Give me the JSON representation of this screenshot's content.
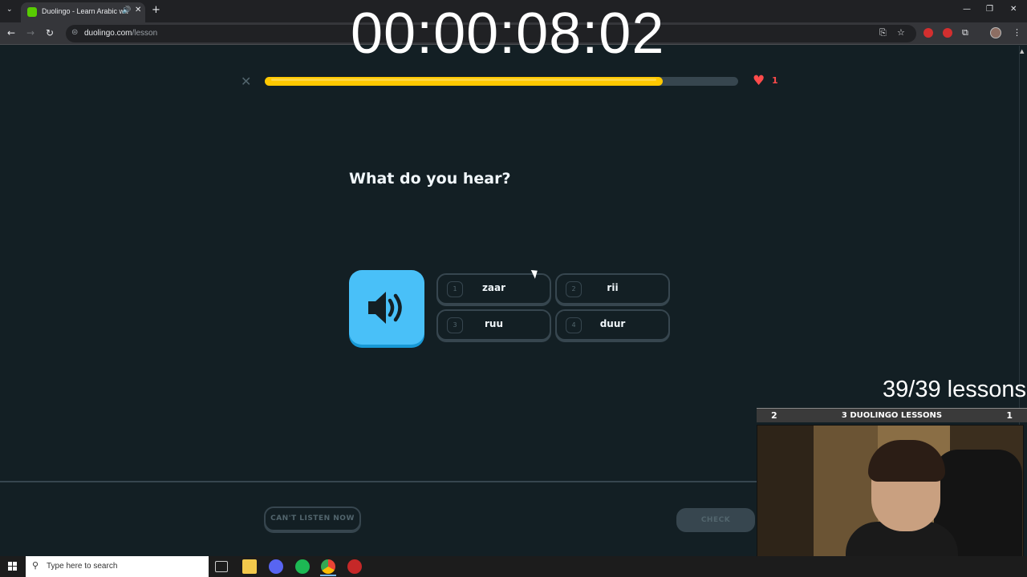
{
  "browser": {
    "tab_title": "Duolingo - Learn Arabic with",
    "url_host": "duolingo.com",
    "url_path": "/lesson"
  },
  "overlay": {
    "timer": "00:00:08:02",
    "lessons_count": "39/39 lessons",
    "banner_left": "2",
    "banner_title": "3 DUOLINGO LESSONS",
    "banner_right": "1"
  },
  "lesson": {
    "progress": 0.84,
    "hearts": "1",
    "question": "What do you hear?",
    "options": [
      {
        "num": "1",
        "label": "zaar"
      },
      {
        "num": "2",
        "label": "rii"
      },
      {
        "num": "3",
        "label": "ruu"
      },
      {
        "num": "4",
        "label": "duur"
      }
    ],
    "cant_listen_label": "CAN'T LISTEN NOW",
    "check_label": "CHECK"
  },
  "taskbar": {
    "search_placeholder": "Type here to search"
  },
  "colors": {
    "background": "#131f24",
    "progress": "#ffc800",
    "speaker": "#49c0f8",
    "heart": "#ff4b4b"
  }
}
